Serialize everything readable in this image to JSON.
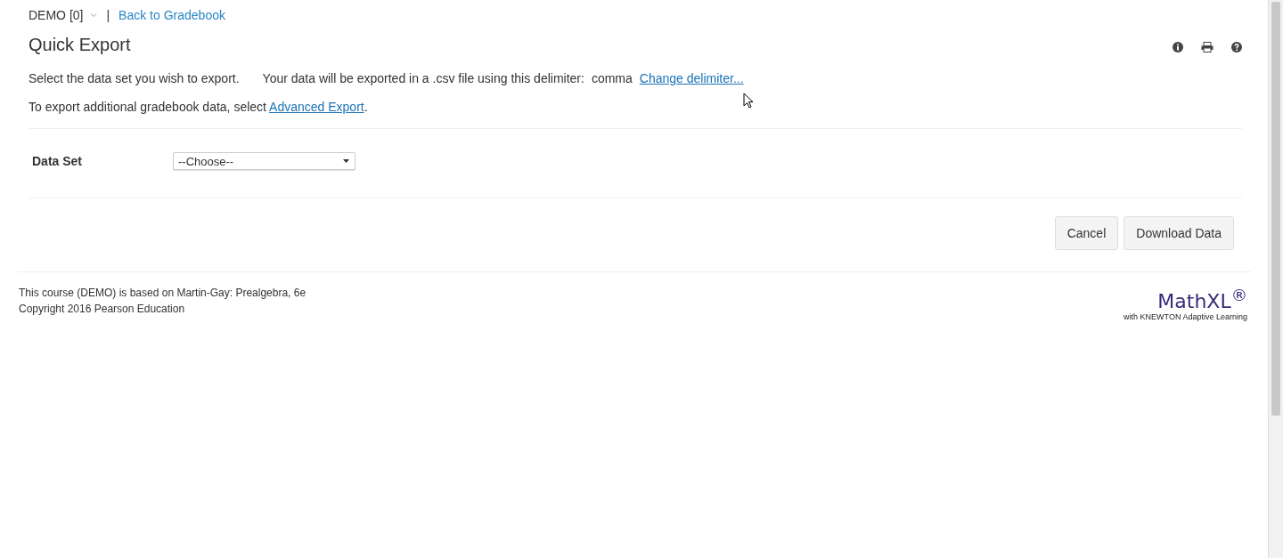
{
  "breadcrumb": {
    "course": "DEMO [0]",
    "separator": "|",
    "back_link": "Back to Gradebook"
  },
  "title": "Quick Export",
  "toolbar_icons": [
    {
      "kind": "info"
    },
    {
      "kind": "print"
    },
    {
      "kind": "help"
    }
  ],
  "intro": {
    "text": "Select the data set you wish to export.",
    "delimiter_text": "Your data will be exported in a .csv file using this delimiter:",
    "delimiter": "comma",
    "change_link": "Change delimiter..."
  },
  "advanced": {
    "text": "To export additional gradebook data, select ",
    "link": "Advanced Export",
    "end": "."
  },
  "form": {
    "label": "Data Set",
    "select_value": "--Choose--"
  },
  "buttons": [
    {
      "label": "Cancel"
    },
    {
      "label": "Download Data"
    }
  ],
  "footer": {
    "lines": [
      "This course (DEMO) is based on Martin-Gay: Prealgebra, 6e",
      "Copyright 2016 Pearson Education"
    ],
    "logo": "MathXL$^{®}$",
    "logo_sub": "with KNEWTON Adaptive Learning"
  }
}
